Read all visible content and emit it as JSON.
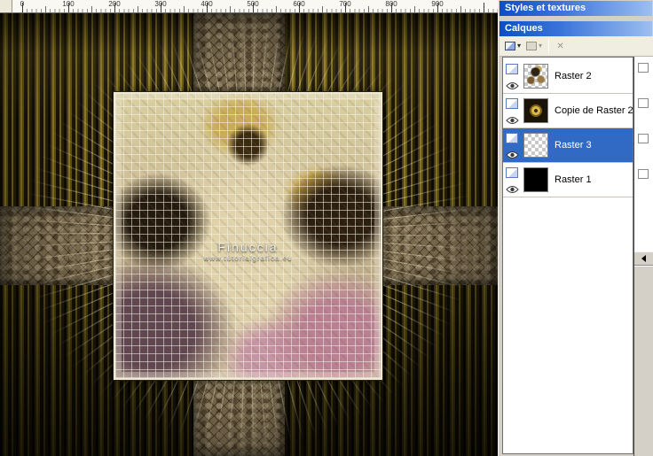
{
  "canvas": {
    "ruler_labels": [
      "0",
      "100",
      "200",
      "300",
      "400",
      "500",
      "600",
      "700",
      "800",
      "900"
    ],
    "watermark": {
      "line1": "Finuccia",
      "line2": "www.tutorialgrafica.eu"
    }
  },
  "styles_palette": {
    "title": "Styles et textures"
  },
  "layers_palette": {
    "title": "Calques",
    "selected_layer": "Raster 3",
    "layers": [
      {
        "name": "Raster 2"
      },
      {
        "name": "Copie de Raster 2"
      },
      {
        "name": "Raster 3"
      },
      {
        "name": "Raster 1"
      }
    ]
  },
  "colors": {
    "selection_blue": "#316ac5",
    "titlebar_gradient_start": "#0b4fc4",
    "titlebar_gradient_end": "#9dbff0",
    "canvas_gold": "#a28c2c",
    "panel_grey": "#d4d0c8"
  }
}
